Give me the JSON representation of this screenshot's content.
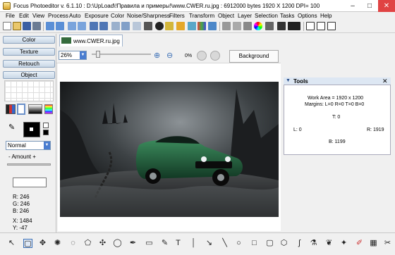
{
  "window": {
    "title": "Focus Photoeditor v. 6.1.10 :  D:\\UpLoad\\!Правила и примеры!\\www.CWER.ru.jpg : 6912000 bytes    1920 X 1200  DPI= 100",
    "minimize": "–",
    "maximize": "□",
    "close": "✕"
  },
  "menu": [
    "File",
    "Edit",
    "View",
    "Process",
    "Auto",
    "Exposure",
    "Color",
    "Noise/Sharpness",
    "Filters",
    "Transform",
    "Object",
    "Layer",
    "Selection",
    "Tasks",
    "Options",
    "Help"
  ],
  "left_panel": {
    "tabs": [
      "Color",
      "Texture",
      "Retouch",
      "Object"
    ],
    "blend_mode": "Normal",
    "amount_label": "- Amount +",
    "readout": {
      "r": "R: 246",
      "g": "G: 246",
      "b": "B: 246",
      "x": "X: 1484",
      "y": "Y: -47"
    }
  },
  "document": {
    "tab_label": "www.CWER.ru.jpg",
    "zoom": "26%",
    "percent": "0%",
    "background_button": "Background"
  },
  "tools_panel": {
    "title": "Tools",
    "work_area": "Work Area = 1920 x 1200",
    "margins": "Margins: L=0 R=0 T=0 B=0",
    "t": "T: 0",
    "l": "L: 0",
    "r": "R: 1919",
    "b": "B: 1199"
  },
  "colors": {
    "accent": "#4a7dd0",
    "close": "#e04343",
    "car": "#1f5d3a"
  }
}
